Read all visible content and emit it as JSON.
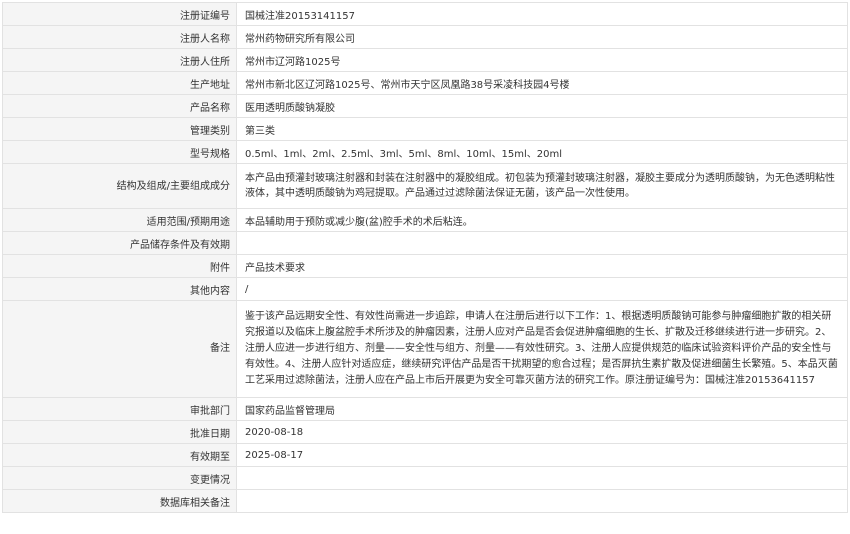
{
  "rows": [
    {
      "label": "注册证编号",
      "value": "国械注准20153141157"
    },
    {
      "label": "注册人名称",
      "value": "常州药物研究所有限公司"
    },
    {
      "label": "注册人住所",
      "value": "常州市辽河路1025号"
    },
    {
      "label": "生产地址",
      "value": "常州市新北区辽河路1025号、常州市天宁区凤凰路38号采凌科技园4号楼"
    },
    {
      "label": "产品名称",
      "value": "医用透明质酸钠凝胶"
    },
    {
      "label": "管理类别",
      "value": "第三类"
    },
    {
      "label": "型号规格",
      "value": "0.5ml、1ml、2ml、2.5ml、3ml、5ml、8ml、10ml、15ml、20ml"
    },
    {
      "label": "结构及组成/主要组成成分",
      "value": "本产品由预灌封玻璃注射器和封装在注射器中的凝胶组成。初包装为预灌封玻璃注射器，凝胶主要成分为透明质酸钠，为无色透明粘性液体，其中透明质酸钠为鸡冠提取。产品通过过滤除菌法保证无菌，该产品一次性使用。"
    },
    {
      "label": "适用范围/预期用途",
      "value": "本品辅助用于预防或减少腹(盆)腔手术的术后粘连。"
    },
    {
      "label": "产品储存条件及有效期",
      "value": ""
    },
    {
      "label": "附件",
      "value": "产品技术要求"
    },
    {
      "label": "其他内容",
      "value": "/"
    },
    {
      "label": "备注",
      "value": "鉴于该产品远期安全性、有效性尚需进一步追踪，申请人在注册后进行以下工作：1、根据透明质酸钠可能参与肿瘤细胞扩散的相关研究报道以及临床上腹盆腔手术所涉及的肿瘤因素，注册人应对产品是否会促进肿瘤细胞的生长、扩散及迁移继续进行进一步研究。2、注册人应进一步进行组方、剂量——安全性与组方、剂量——有效性研究。3、注册人应提供规范的临床试验资料评价产品的安全性与有效性。4、注册人应针对适应症，继续研究评估产品是否干扰期望的愈合过程；是否屏抗生素扩散及促进细菌生长繁殖。5、本品灭菌工艺采用过滤除菌法，注册人应在产品上市后开展更为安全可靠灭菌方法的研究工作。原注册证编号为：国械注准20153641157"
    },
    {
      "label": "审批部门",
      "value": "国家药品监督管理局"
    },
    {
      "label": "批准日期",
      "value": "2020-08-18"
    },
    {
      "label": "有效期至",
      "value": "2025-08-17"
    },
    {
      "label": "变更情况",
      "value": ""
    },
    {
      "label": "数据库相关备注",
      "value": ""
    }
  ]
}
